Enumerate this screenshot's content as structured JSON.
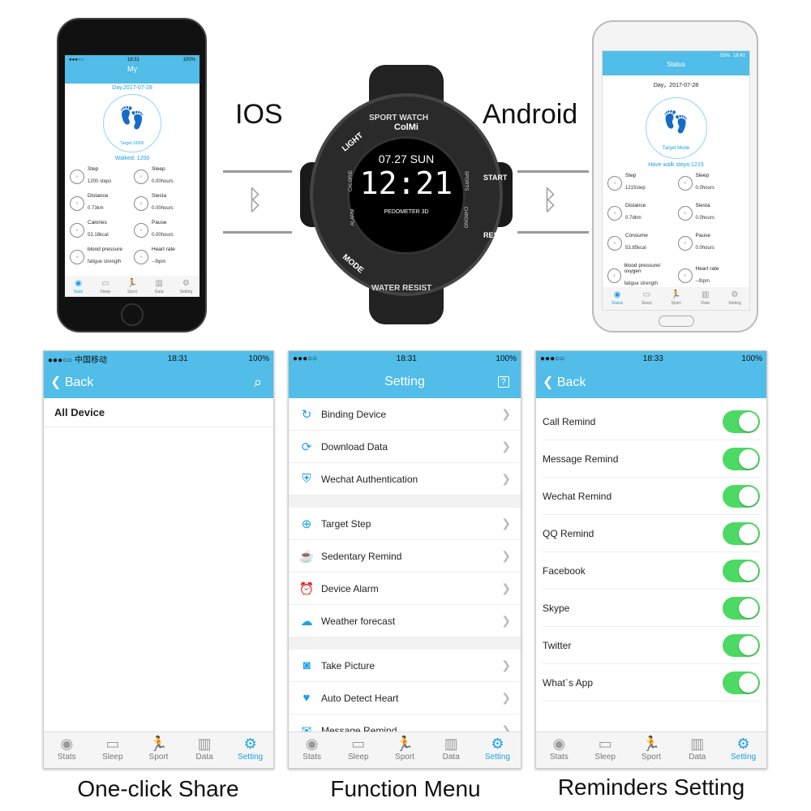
{
  "labels": {
    "ios": "IOS",
    "android": "Android",
    "bluetooth_icon": "bluetooth-icon"
  },
  "colors": {
    "accent": "#51bde8",
    "toggle_on": "#4cd964",
    "tab_active": "#1aa1e6"
  },
  "ios_phone": {
    "status_time": "18:31",
    "status_battery": "100%",
    "title": "My",
    "date": "Day,2017-07-28",
    "target": "Target:10000",
    "walked": "Walked: 1200",
    "stats": [
      {
        "label": "Step",
        "value": "1200 steps"
      },
      {
        "label": "Sleep",
        "value": "0.00hours"
      },
      {
        "label": "Distance",
        "value": "0.73km"
      },
      {
        "label": "Siesta",
        "value": "0.00hours"
      },
      {
        "label": "Calories",
        "value": "53.18kcal"
      },
      {
        "label": "Pause",
        "value": "0.00hours"
      },
      {
        "label": "blood pressure",
        "value": "fatigue strength"
      },
      {
        "label": "Heart rate",
        "value": "--/bpm"
      }
    ],
    "tabs": [
      "Stats",
      "Sleep",
      "Sport",
      "Data",
      "Setting"
    ]
  },
  "android_phone": {
    "status_time": "18:41",
    "status_battery": "53%",
    "title": "Status",
    "date": "Day，2017-07-28",
    "target": "Target Mode",
    "walked": "Have walk steps:1215",
    "stats": [
      {
        "label": "Step",
        "value": "1215step"
      },
      {
        "label": "Sleep",
        "value": "0.0hours"
      },
      {
        "label": "Distance",
        "value": "0.7dkm"
      },
      {
        "label": "Siesta",
        "value": "0.0hours"
      },
      {
        "label": "Consume",
        "value": "53.85kcal"
      },
      {
        "label": "Pause",
        "value": "0.0hours"
      },
      {
        "label": "blood pressure/ oxygen",
        "value": "fatigue strength"
      },
      {
        "label": "Heart rate",
        "value": "--/bpm"
      }
    ],
    "tabs": [
      "Status",
      "Sleep",
      "Sport",
      "Data",
      "Setting"
    ]
  },
  "watch": {
    "brand": "ColMi",
    "top_ring": "SPORT WATCH",
    "bottom_ring": "WATER RESIST",
    "light": "LIGHT",
    "mode": "MODE",
    "start": "START",
    "reset": "RESET",
    "date": "07.27 SUN",
    "time": "12:21",
    "pedometer": "PEDOMETER 3D",
    "calorie": "CALORIE",
    "alarm": "ALARM",
    "chrono": "CHRONO",
    "sports": "SPORTS"
  },
  "screen1": {
    "carrier": "●●●○○ 中国移动",
    "time": "18:31",
    "battery": "100%",
    "back": "Back",
    "section": "All Device",
    "caption": "One-click Share"
  },
  "screen2": {
    "carrier": "●●●○○",
    "time": "18:31",
    "battery": "100%",
    "title": "Setting",
    "caption": "Function Menu",
    "groups": [
      [
        {
          "label": "Binding Device",
          "icon": "lock-sync-icon",
          "glyph": "↻"
        },
        {
          "label": "Download Data",
          "icon": "sync-icon",
          "glyph": "⟳"
        },
        {
          "label": "Wechat Authentication",
          "icon": "shield-icon",
          "glyph": "⛨"
        }
      ],
      [
        {
          "label": "Target Step",
          "icon": "target-icon",
          "glyph": "⊕"
        },
        {
          "label": "Sedentary Remind",
          "icon": "coffee-cup-icon",
          "glyph": "☕"
        },
        {
          "label": "Device Alarm",
          "icon": "alarm-clock-icon",
          "glyph": "⏰"
        },
        {
          "label": "Weather forecast",
          "icon": "cloud-icon",
          "glyph": "☁"
        }
      ],
      [
        {
          "label": "Take Picture",
          "icon": "camera-icon",
          "glyph": "◙"
        },
        {
          "label": "Auto Detect Heart",
          "icon": "heart-icon",
          "glyph": "♥"
        },
        {
          "label": "Message Remind",
          "icon": "envelope-icon",
          "glyph": "✉"
        }
      ]
    ]
  },
  "screen3": {
    "carrier": "●●●○○",
    "time": "18:33",
    "battery": "100%",
    "back": "Back",
    "caption": "Reminders Setting",
    "toggles": [
      {
        "label": "Call Remind",
        "on": true
      },
      {
        "label": "Message Remind",
        "on": true
      },
      {
        "label": "Wechat Remind",
        "on": true
      },
      {
        "label": "QQ Remind",
        "on": true
      },
      {
        "label": "Facebook",
        "on": true
      },
      {
        "label": "Skype",
        "on": true
      },
      {
        "label": "Twitter",
        "on": true
      },
      {
        "label": "What`s App",
        "on": true
      }
    ]
  },
  "bottom_tabs": [
    "Stats",
    "Sleep",
    "Sport",
    "Data",
    "Setting"
  ]
}
